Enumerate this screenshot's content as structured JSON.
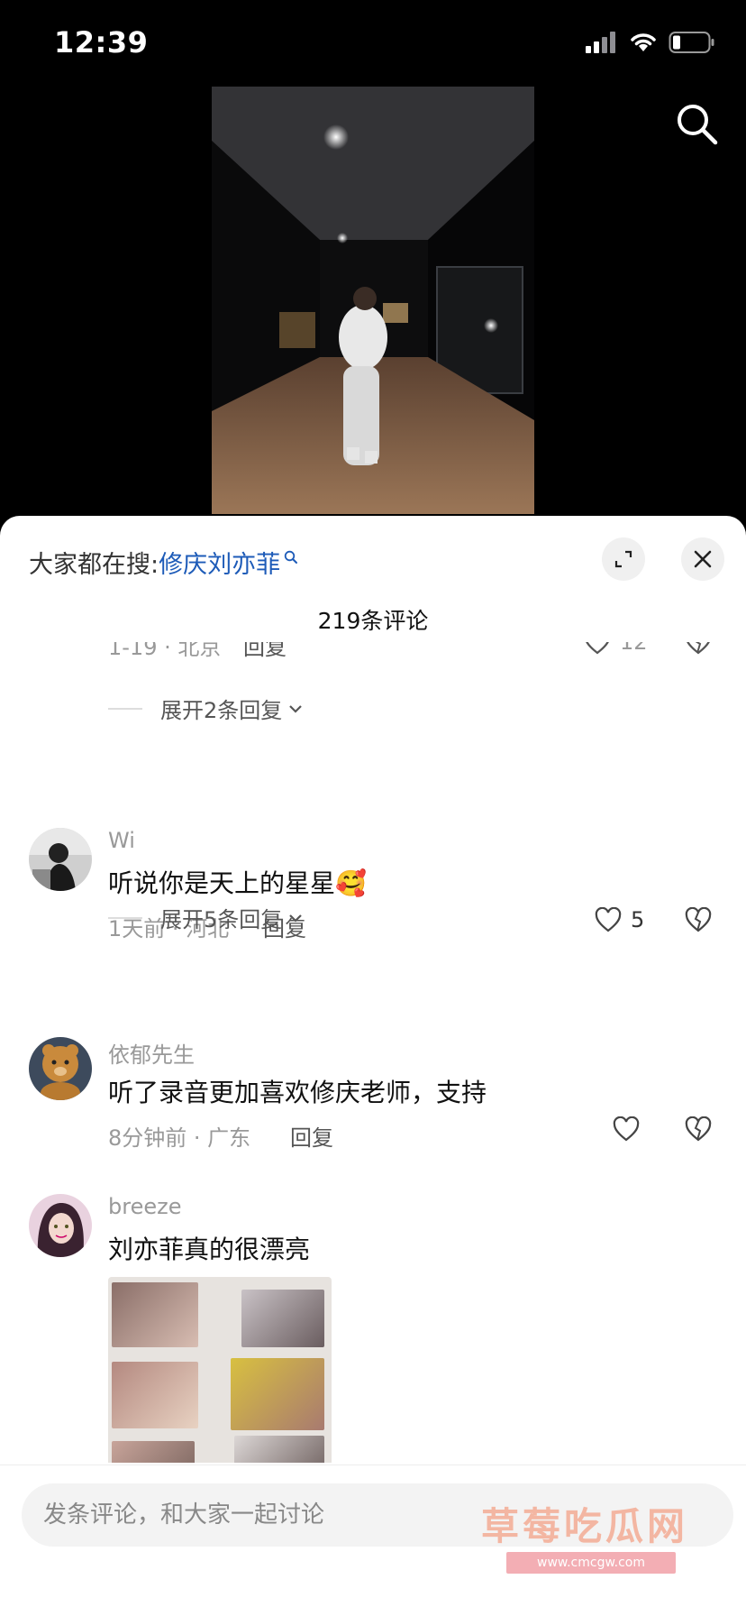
{
  "status_bar": {
    "time": "12:39"
  },
  "sheet": {
    "search_label": "大家都在搜:",
    "search_term": "修庆刘亦菲",
    "comment_count": "219条评论"
  },
  "comments": {
    "cut": {
      "meta": "1-19 · 北京",
      "reply": "回复",
      "likes": "12"
    },
    "expand_1": "展开2条回复",
    "c1": {
      "user": "Wi",
      "text": "听说你是天上的星星🥰",
      "meta": "1天前 · 河北",
      "reply": "回复",
      "likes": "5"
    },
    "expand_2": "展开5条回复",
    "c2": {
      "user": "依郁先生",
      "text": "听了录音更加喜欢修庆老师，支持",
      "meta": "8分钟前 · 广东",
      "reply": "回复"
    },
    "c3": {
      "user": "breeze",
      "text": "刘亦菲真的很漂亮"
    }
  },
  "input": {
    "placeholder": "发条评论，和大家一起讨论"
  },
  "watermark": {
    "title": "草莓吃瓜网",
    "url": "www.cmcgw.com"
  },
  "colors": {
    "link": "#1d5bb8",
    "muted": "#999999",
    "sheet_bg": "#ffffff",
    "status_bg": "#000000"
  }
}
